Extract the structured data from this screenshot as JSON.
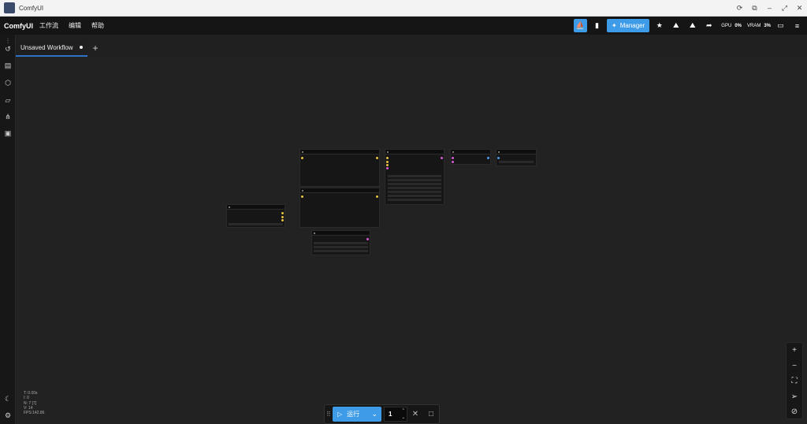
{
  "window": {
    "title": "ComfyUI"
  },
  "menubar": {
    "brand": "ComfyUI",
    "items": [
      "工作流",
      "编辑",
      "帮助"
    ],
    "manager_label": "Manager",
    "gpu_label": "GPU",
    "gpu_value": "0%",
    "vram_label": "VRAM",
    "vram_value": "3%"
  },
  "tabs": [
    {
      "label": "Unsaved Workflow",
      "unsaved": true
    }
  ],
  "new_tab_label": "+",
  "stats": {
    "t": "T: 0.00s",
    "i": "I: 0",
    "n": "N: 7 [7]",
    "v": "V: 14",
    "fps": "FPS:142.86"
  },
  "runbar": {
    "run_label": "运行",
    "queue_count": "1"
  },
  "colors": {
    "accent": "#3e9be8",
    "canvas": "#222222",
    "port_yellow": "#e8c23e",
    "port_pink": "#d65ad6",
    "port_blue": "#4a9be8"
  }
}
